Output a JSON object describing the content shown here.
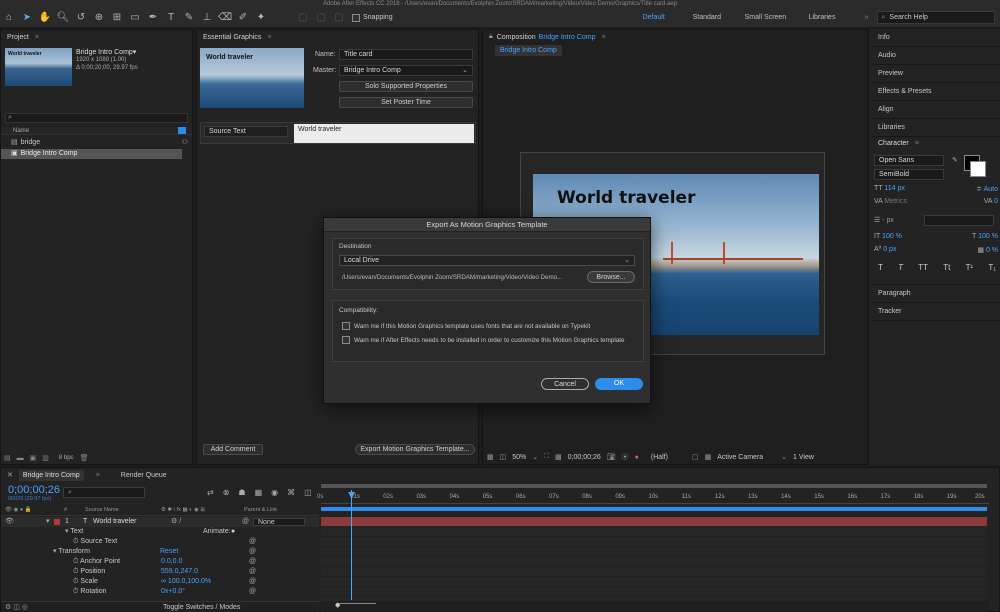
{
  "window_title": "Adobe After Effects CC 2018 - /Users/evan/Documents/Evolphin Zoom/SRDAM/marketing/Video/Video Demo/Graphics/Title card.aep",
  "toolbar": {
    "snapping_label": "Snapping",
    "workspaces": [
      "Default",
      "Standard",
      "Small Screen",
      "Libraries"
    ],
    "active_workspace": "Default",
    "search_placeholder": "Search Help"
  },
  "project": {
    "tab_label": "Project",
    "thumb_text": "World traveler",
    "comp_name": "Bridge Intro Comp▾",
    "comp_res": "1920 x 1080 (1.00)",
    "comp_dur": "Δ 0;00;20;00, 29.97 fps",
    "col_name": "Name",
    "items": [
      "bridge",
      "Bridge Intro Comp"
    ],
    "bpc": "8 bpc"
  },
  "essential": {
    "tab_label": "Essential Graphics",
    "thumb_text": "World traveler",
    "name_label": "Name:",
    "name_value": "Title card",
    "master_label": "Master:",
    "master_value": "Bridge Intro Comp",
    "solo_button": "Solo Supported Properties",
    "poster_button": "Set Poster Time",
    "source_text_label": "Source Text",
    "source_text_value": "World traveler",
    "add_comment": "Add Comment",
    "export_button": "Export Motion Graphics Template..."
  },
  "composition": {
    "tab_prefix": "Composition",
    "tab_name": "Bridge Intro Comp",
    "subtab": "Bridge Intro Comp",
    "title_text": "World traveler",
    "zoom": "50%",
    "timecode": "0;00;00;26",
    "resolution": "(Half)",
    "camera": "Active Camera",
    "view": "1 View"
  },
  "right_panels": [
    "Info",
    "Audio",
    "Preview",
    "Effects & Presets",
    "Align",
    "Libraries"
  ],
  "character": {
    "tab_label": "Character",
    "font": "Open Sans",
    "style": "SemiBold",
    "size": "114 px",
    "leading": "Auto",
    "kerning": "Metrics",
    "tracking": "0",
    "stroke": "- px",
    "vscale": "100 %",
    "hscale": "100 %",
    "baseline": "0 px",
    "tsume": "0 %",
    "styles": [
      "T",
      "T",
      "TT",
      "Tt",
      "T¹",
      "T₁"
    ]
  },
  "bottom_right_panels": [
    "Paragraph",
    "Tracker"
  ],
  "timeline": {
    "tab_label": "Bridge Intro Comp",
    "render_queue": "Render Queue",
    "timecode": "0;00;00;26",
    "frame_info": "00026 (29.97 fps)",
    "col_source": "Source Name",
    "col_parent": "Parent & Link",
    "layer_number": "1",
    "layer_name": "World traveler",
    "parent_value": "None",
    "animate_label": "Animate:",
    "text_group": "Text",
    "source_text": "Source Text",
    "transform_group": "Transform",
    "reset": "Reset",
    "props": [
      {
        "name": "Anchor Point",
        "value": "0.0,0.0"
      },
      {
        "name": "Position",
        "value": "559.0,247.0"
      },
      {
        "name": "Scale",
        "value": "∞ 100.0,100.0%"
      },
      {
        "name": "Rotation",
        "value": "0x+0.0°"
      }
    ],
    "toggle_label": "Toggle Switches / Modes",
    "ruler": [
      "0s",
      "01s",
      "02s",
      "03s",
      "04s",
      "05s",
      "06s",
      "07s",
      "08s",
      "09s",
      "10s",
      "11s",
      "12s",
      "13s",
      "14s",
      "15s",
      "16s",
      "17s",
      "18s",
      "19s",
      "20s"
    ]
  },
  "dialog": {
    "title": "Export As Motion Graphics Template",
    "destination_label": "Destination",
    "destination_value": "Local Drive",
    "path": "/Users/evan/Documents/Evolphin Zoom/SRDAM/marketing/Video/Video Demo...",
    "browse": "Browse...",
    "compat_label": "Compatibility:",
    "check1": "Warn me if this Motion Graphics template uses fonts that are not available on Typekit",
    "check2": "Warn me if After Effects needs to be installed in order to customize this Motion Graphics template",
    "cancel": "Cancel",
    "ok": "OK"
  },
  "colors": {
    "accent": "#2d8ceb",
    "layer_bar": "#8a3a3a",
    "playhead": "#4aa3ff"
  }
}
